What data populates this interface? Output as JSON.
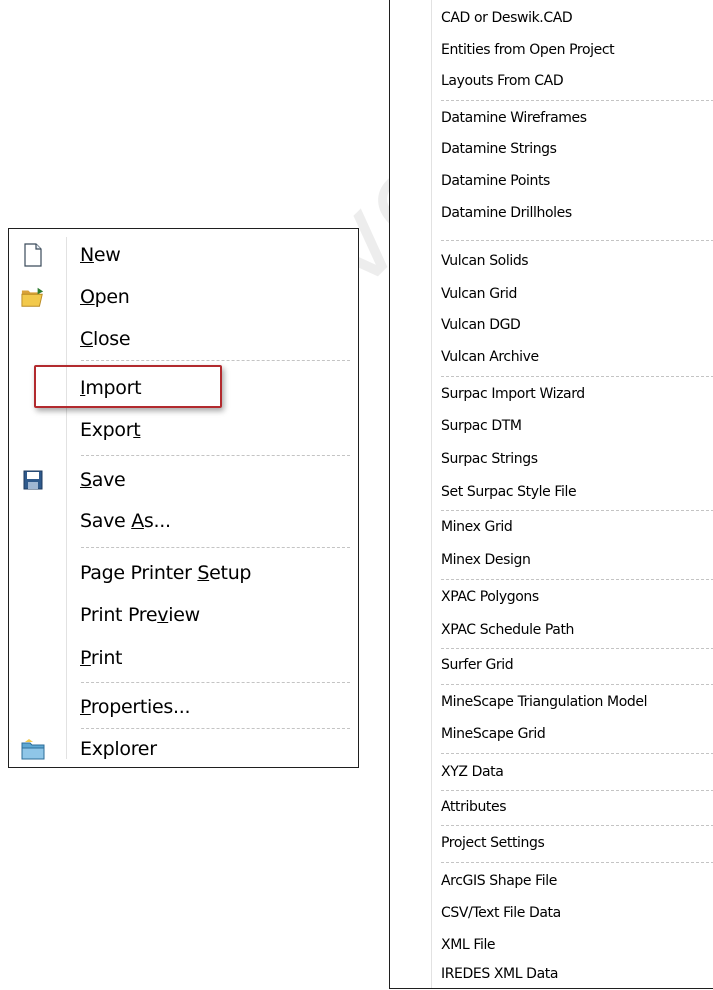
{
  "file_menu": {
    "items": [
      {
        "key": "new",
        "pre": "",
        "acc": "N",
        "post": "ew",
        "icon": "new-document-icon"
      },
      {
        "key": "open",
        "pre": "",
        "acc": "O",
        "post": "pen",
        "icon": "open-folder-icon"
      },
      {
        "key": "close",
        "pre": "",
        "acc": "C",
        "post": "lose",
        "icon": ""
      },
      {
        "key": "import",
        "pre": "",
        "acc": "I",
        "post": "mport",
        "icon": ""
      },
      {
        "key": "export",
        "pre": "Expor",
        "acc": "t",
        "post": "",
        "icon": ""
      },
      {
        "key": "save",
        "pre": "",
        "acc": "S",
        "post": "ave",
        "icon": "save-disk-icon"
      },
      {
        "key": "save_as",
        "pre": "Save ",
        "acc": "A",
        "post": "s...",
        "icon": ""
      },
      {
        "key": "page_printer_setup",
        "pre": "Page Printer ",
        "acc": "S",
        "post": "etup",
        "icon": ""
      },
      {
        "key": "print_preview",
        "pre": "Print Pre",
        "acc": "v",
        "post": "iew",
        "icon": ""
      },
      {
        "key": "print",
        "pre": "",
        "acc": "P",
        "post": "rint",
        "icon": ""
      },
      {
        "key": "properties",
        "pre": "",
        "acc": "P",
        "post": "roperties...",
        "icon": ""
      },
      {
        "key": "explorer",
        "pre": "Explorer",
        "acc": "",
        "post": "",
        "icon": "explorer-icon"
      }
    ],
    "highlighted": "Import"
  },
  "import_menu": {
    "items": [
      "CAD or Deswik.CAD",
      "Entities from Open Project",
      "Layouts From CAD",
      "Datamine Wireframes",
      "Datamine Strings",
      "Datamine Points",
      "Datamine Drillholes",
      "Vulcan Solids",
      "Vulcan Grid",
      "Vulcan DGD",
      "Vulcan Archive",
      "Surpac Import Wizard",
      "Surpac DTM",
      "Surpac Strings",
      "Set Surpac Style File",
      "Minex Grid",
      "Minex Design",
      "XPAC Polygons",
      "XPAC Schedule Path",
      "Surfer Grid",
      "MineScape Triangulation Model",
      "MineScape Grid",
      "XYZ Data",
      "Attributes",
      "Project Settings",
      "ArcGIS Shape File",
      "CSV/Text File Data",
      "XML File",
      "IREDES XML Data"
    ]
  },
  "watermark": "Buenaventura – Nov 20",
  "colors": {
    "highlight_border": "#b22a2e",
    "menu_border": "#1f1f1f",
    "separator": "#c4c4c4"
  }
}
